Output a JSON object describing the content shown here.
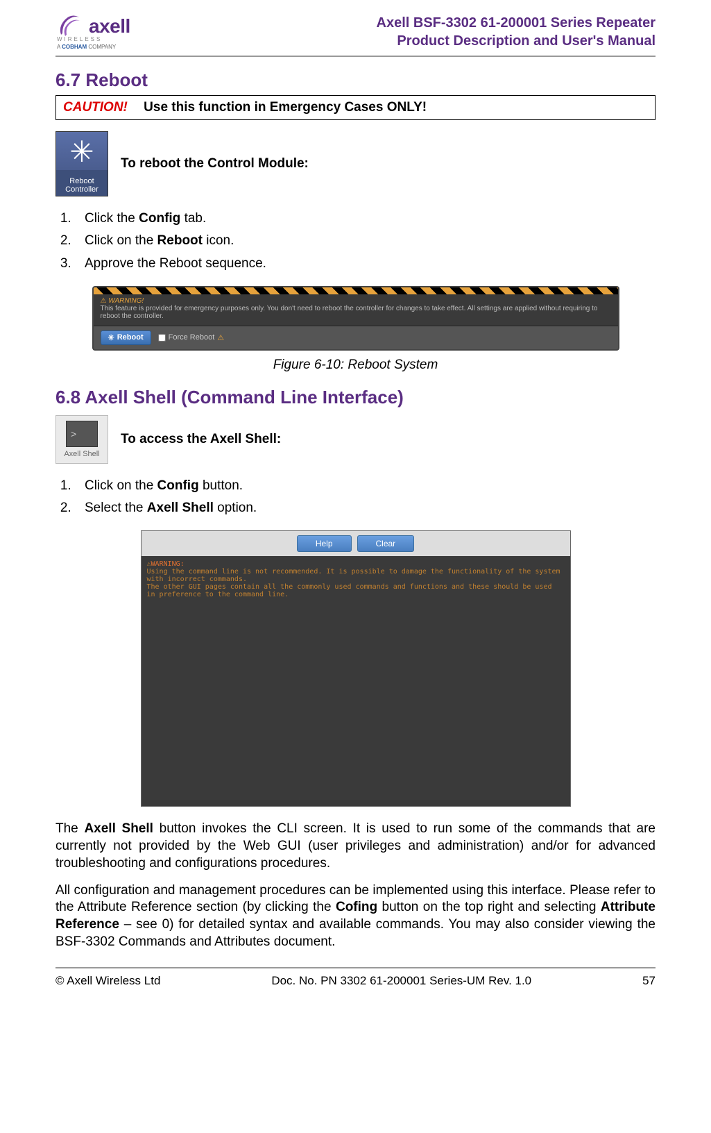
{
  "header": {
    "logo_text": "axell",
    "logo_sub": "WIRELESS",
    "logo_tag_prefix": "A ",
    "logo_tag_brand": "COBHAM",
    "logo_tag_suffix": " COMPANY",
    "title_line1": "Axell BSF-3302 61-200001 Series Repeater",
    "title_line2": "Product Description and User's Manual"
  },
  "section67": {
    "heading": "6.7    Reboot",
    "caution_label": "CAUTION!",
    "caution_text": "Use this function in Emergency Cases ONLY!",
    "icon_label_line1": "Reboot",
    "icon_label_line2": "Controller",
    "icon_instruction": "To reboot the Control Module:",
    "steps": [
      {
        "pre": "Click the ",
        "bold": "Config",
        "post": " tab."
      },
      {
        "pre": "Click on the ",
        "bold": "Reboot",
        "post": " icon."
      },
      {
        "pre": "Approve the Reboot sequence.",
        "bold": "",
        "post": ""
      }
    ],
    "figure": {
      "warning_title": "WARNING!",
      "warning_text": "This feature is provided for emergency purposes only. You don't need to reboot the controller for changes to take effect. All settings are applied without requiring to reboot the controller.",
      "reboot_button": "Reboot",
      "force_label": "Force Reboot",
      "caption": "Figure 6-10:  Reboot System"
    }
  },
  "section68": {
    "heading": "6.8    Axell Shell (Command Line Interface)",
    "icon_label": "Axell Shell",
    "icon_instruction": "To access the Axell Shell:",
    "steps": [
      {
        "pre": "Click on the ",
        "bold": "Config",
        "post": " button."
      },
      {
        "pre": "Select the ",
        "bold": "Axell Shell",
        "post": " option."
      }
    ],
    "figure": {
      "help_button": "Help",
      "clear_button": "Clear",
      "warning_title": "WARNING:",
      "warning_line1": "Using the command line is not recommended. It is possible to damage the functionality of the system with incorrect commands.",
      "warning_line2": "The other GUI pages contain all the commonly used commands and functions and these should be used in preference to the command line."
    },
    "para1_pre": "The ",
    "para1_bold": "Axell Shell",
    "para1_post": " button invokes the CLI screen. It is used to run some of the commands that are currently not provided by the Web GUI (user privileges and administration) and/or for advanced troubleshooting and configurations procedures.",
    "para2_pre": "All configuration and management procedures can be implemented using this interface. Please refer to the Attribute Reference section (by clicking the ",
    "para2_bold1": "Cofing",
    "para2_mid": " button on the top right and selecting ",
    "para2_bold2": "Attribute Reference",
    "para2_post": " – see 0) for detailed syntax and available commands. You may also consider viewing the BSF-3302 Commands and Attributes document."
  },
  "footer": {
    "left": "© Axell Wireless Ltd",
    "center": "Doc. No. PN 3302 61-200001 Series-UM Rev. 1.0",
    "right": "57"
  }
}
